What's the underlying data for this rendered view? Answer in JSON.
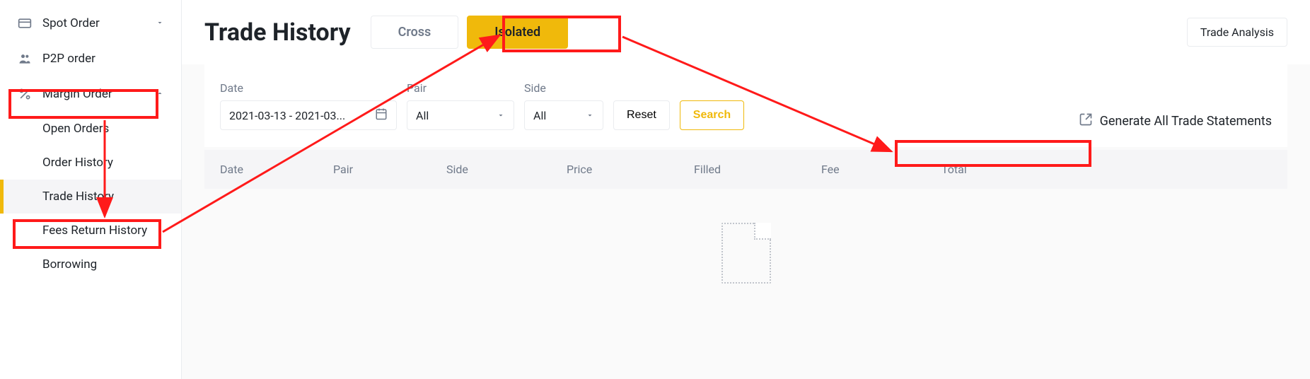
{
  "sidebar": {
    "spot_order": "Spot Order",
    "p2p_order": "P2P order",
    "margin_order": "Margin Order",
    "open_orders": "Open Orders",
    "order_history": "Order History",
    "trade_history": "Trade History",
    "fees_return_history": "Fees Return History",
    "borrowing": "Borrowing"
  },
  "header": {
    "title": "Trade History",
    "tab_cross": "Cross",
    "tab_isolated": "Isolated",
    "trade_analysis": "Trade Analysis"
  },
  "filters": {
    "date_label": "Date",
    "date_value": "2021-03-13 - 2021-03...",
    "pair_label": "Pair",
    "pair_value": "All",
    "side_label": "Side",
    "side_value": "All",
    "reset": "Reset",
    "search": "Search",
    "generate": "Generate All Trade Statements"
  },
  "table": {
    "date": "Date",
    "pair": "Pair",
    "side": "Side",
    "price": "Price",
    "filled": "Filled",
    "fee": "Fee",
    "total": "Total"
  }
}
